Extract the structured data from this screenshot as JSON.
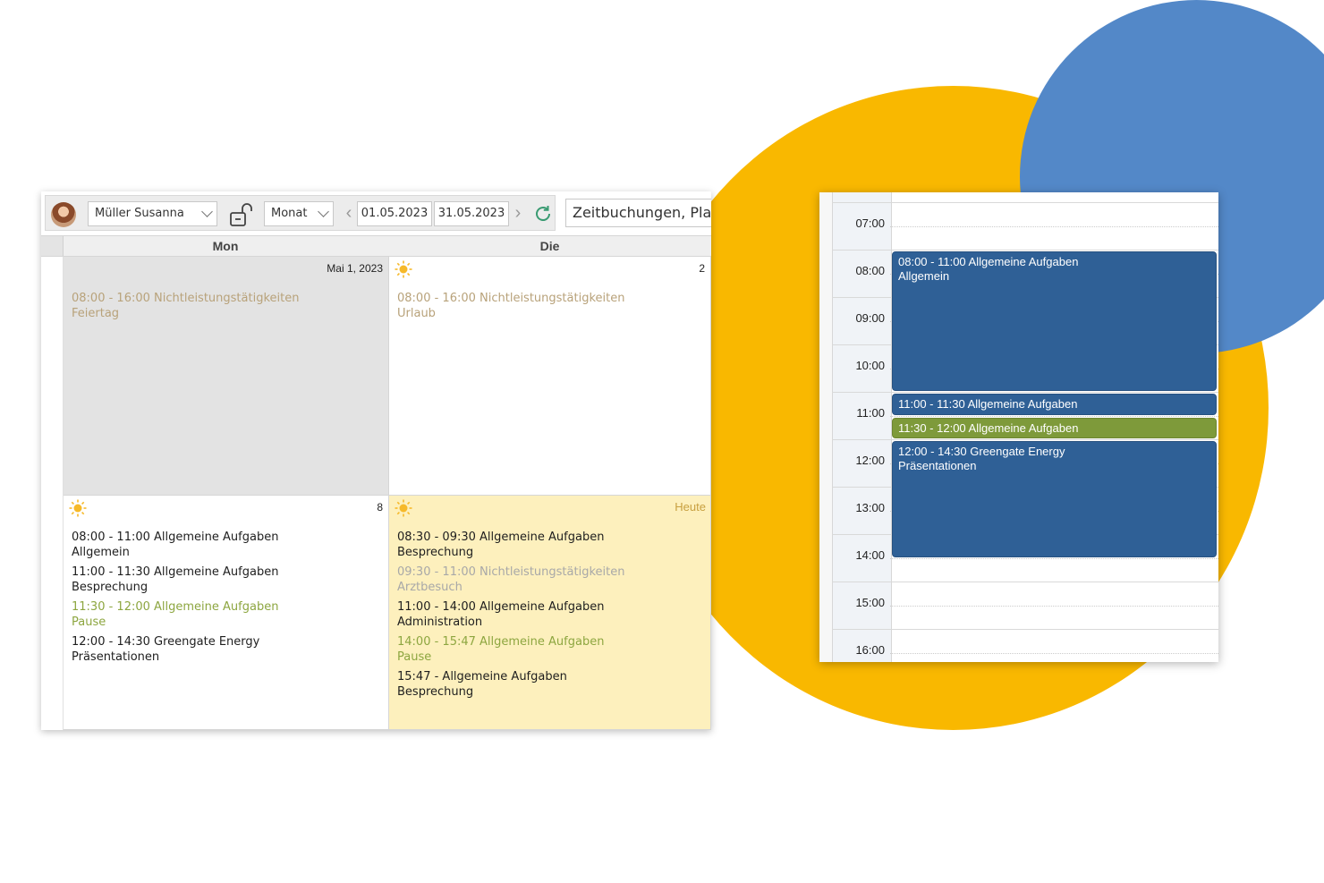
{
  "colors": {
    "accent_yellow": "#f9b800",
    "accent_blue": "#5388c8",
    "event_blue": "#2f6096",
    "event_green": "#7e9a3a",
    "today_bg": "#fdf0bd",
    "holiday_bg": "#e3e3e3"
  },
  "toolbar": {
    "user": "Müller Susanna",
    "view_mode": "Monat",
    "date_from": "01.05.2023",
    "date_to": "31.05.2023",
    "booking_view": "Zeitbuchungen, Pla"
  },
  "month": {
    "day_headers": [
      "Mon",
      "Die"
    ],
    "cells": [
      {
        "date_label": "Mai 1, 2023",
        "entries": [
          {
            "line1": "08:00 - 16:00 Nichtleistungstätigkeiten",
            "line2": "Feiertag"
          }
        ]
      },
      {
        "date_label": "2",
        "entries": [
          {
            "line1": "08:00 - 16:00 Nichtleistungstätigkeiten",
            "line2": "Urlaub"
          }
        ]
      },
      {
        "date_label": "8",
        "entries": [
          {
            "line1": "08:00 - 11:00 Allgemeine Aufgaben",
            "line2": "Allgemein"
          },
          {
            "line1": "11:00 - 11:30 Allgemeine Aufgaben",
            "line2": "Besprechung"
          },
          {
            "line1": "11:30 - 12:00 Allgemeine Aufgaben",
            "line2": "Pause"
          },
          {
            "line1": "12:00 - 14:30 Greengate Energy",
            "line2": "Präsentationen"
          }
        ]
      },
      {
        "date_label": "Heute",
        "entries": [
          {
            "line1": "08:30 - 09:30 Allgemeine Aufgaben",
            "line2": "Besprechung"
          },
          {
            "line1": "09:30 - 11:00 Nichtleistungstätigkeiten",
            "line2": "Arztbesuch"
          },
          {
            "line1": "11:00 - 14:00 Allgemeine Aufgaben",
            "line2": "Administration"
          },
          {
            "line1": "14:00 - 15:47 Allgemeine Aufgaben",
            "line2": "Pause"
          },
          {
            "line1": "15:47 - Allgemeine Aufgaben",
            "line2": "Besprechung"
          }
        ]
      }
    ]
  },
  "day_view": {
    "hours": [
      "07:00",
      "08:00",
      "09:00",
      "10:00",
      "11:00",
      "12:00",
      "13:00",
      "14:00",
      "15:00",
      "16:00"
    ],
    "events": [
      {
        "title": "08:00 - 11:00 Allgemeine Aufgaben",
        "subtitle": "Allgemein",
        "start": "08:00",
        "end": "11:00",
        "color": "blue"
      },
      {
        "title": "11:00 - 11:30 Allgemeine Aufgaben",
        "subtitle": "",
        "start": "11:00",
        "end": "11:30",
        "color": "blue"
      },
      {
        "title": "11:30 - 12:00 Allgemeine Aufgaben",
        "subtitle": "",
        "start": "11:30",
        "end": "12:00",
        "color": "green"
      },
      {
        "title": "12:00 - 14:30 Greengate Energy",
        "subtitle": "Präsentationen",
        "start": "12:00",
        "end": "14:30",
        "color": "blue"
      }
    ]
  }
}
